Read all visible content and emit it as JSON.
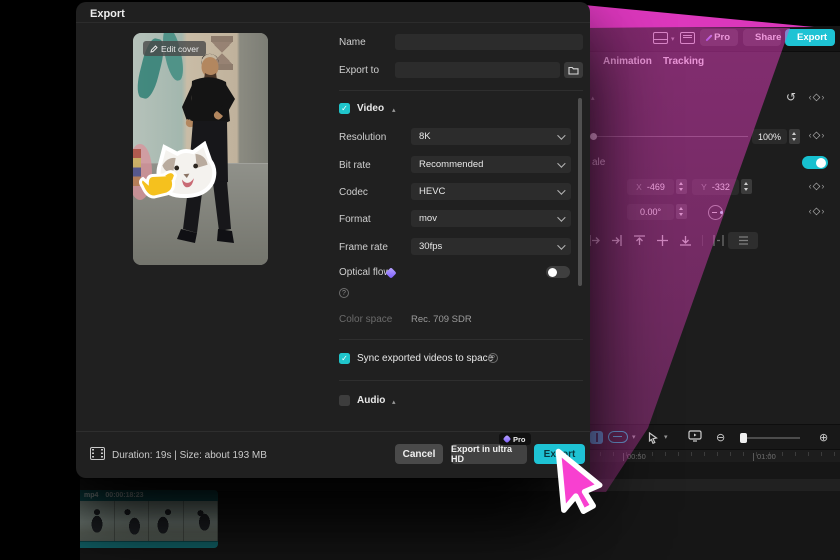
{
  "colors": {
    "accent_teal": "#1ec3d4",
    "magenta": "#ec3ec6",
    "cursor_pink": "#f840d0"
  },
  "dialog": {
    "title": "Export",
    "preview": {
      "edit_cover": "Edit cover"
    },
    "name_label": "Name",
    "export_to_label": "Export to",
    "video": {
      "label": "Video",
      "rows": [
        {
          "label": "Resolution",
          "value": "8K"
        },
        {
          "label": "Bit rate",
          "value": "Recommended"
        },
        {
          "label": "Codec",
          "value": "HEVC"
        },
        {
          "label": "Format",
          "value": "mov"
        },
        {
          "label": "Frame rate",
          "value": "30fps"
        }
      ],
      "optical_flow_label": "Optical flow",
      "color_space_label": "Color space",
      "color_space_value": "Rec. 709 SDR"
    },
    "sync_label": "Sync exported videos to space",
    "audio_label": "Audio",
    "footer": {
      "info": "Duration: 19s | Size: about 193 MB",
      "cancel": "Cancel",
      "ultra": "Export in ultra HD",
      "pro_badge": "Pro",
      "export": "Export"
    }
  },
  "app": {
    "header": {
      "pro": "Pro",
      "share": "Share",
      "export": "Export"
    },
    "tabs": [
      {
        "label": "Animation"
      },
      {
        "label": "Tracking"
      }
    ],
    "inspector": {
      "scale_value": "100%",
      "scale_label_fragment": "ale",
      "x_label": "X",
      "x_value": "-469",
      "y_label": "Y",
      "y_value": "-332",
      "rotation_value": "0.00°"
    },
    "timeline": {
      "ruler": [
        {
          "t": "00:50"
        },
        {
          "t": "01:00"
        }
      ],
      "clip": {
        "format": "mp4",
        "timestamp": "00:00:18:23"
      }
    }
  }
}
